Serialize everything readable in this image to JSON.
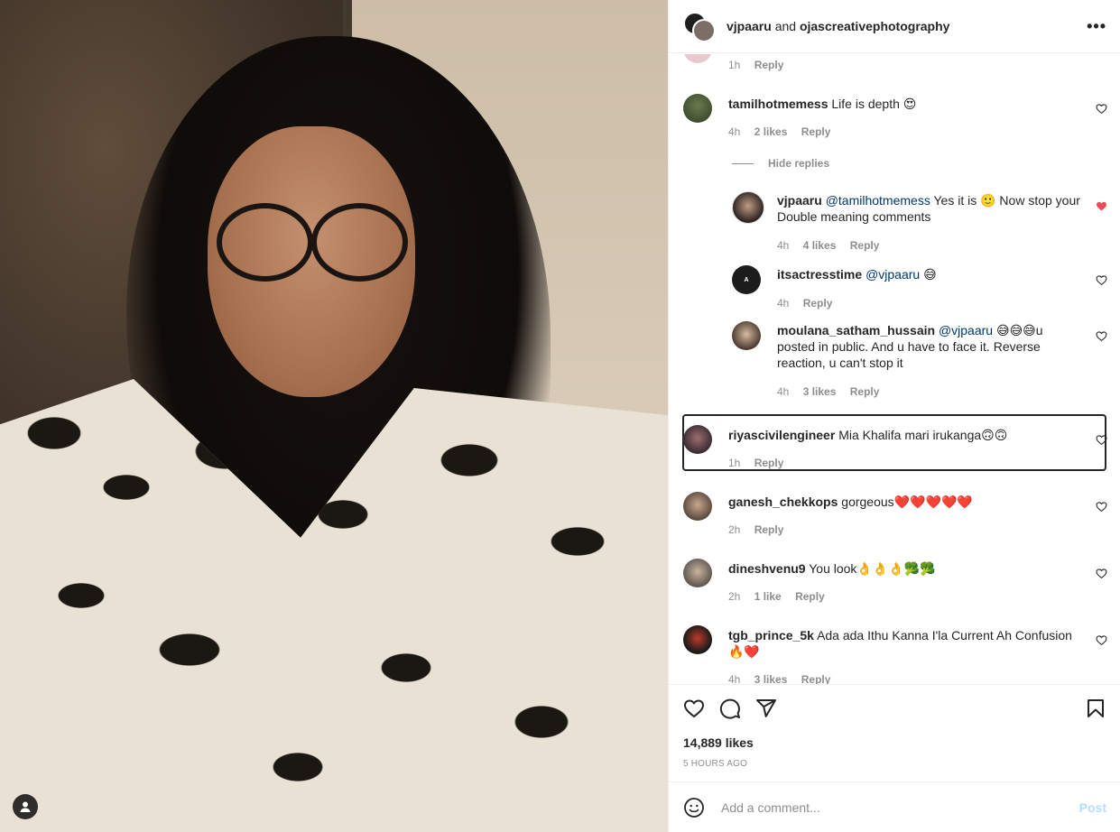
{
  "header": {
    "user1": "vjpaaru",
    "and": "and",
    "user2": "ojascreativephotography",
    "more_label": "•••"
  },
  "top_meta": {
    "time": "1h",
    "reply": "Reply"
  },
  "hide_replies": "Hide replies",
  "comments": [
    {
      "user": "tamilhotmemess",
      "text": "Life is depth 😍",
      "time": "4h",
      "likes": "2 likes",
      "reply": "Reply"
    },
    {
      "user": "vjpaaru",
      "mention": "@tamilhotmemess",
      "text": "Yes it is 🙂 Now stop your Double meaning comments",
      "time": "4h",
      "likes": "4 likes",
      "reply": "Reply",
      "liked": true
    },
    {
      "user": "itsactresstime",
      "mention": "@vjpaaru",
      "text": "😅",
      "time": "4h",
      "likes": "",
      "reply": "Reply"
    },
    {
      "user": "moulana_satham_hussain",
      "mention": "@vjpaaru",
      "text": "😅😅😅u posted in public. And u have to face it. Reverse reaction, u can't stop it",
      "time": "4h",
      "likes": "3 likes",
      "reply": "Reply"
    },
    {
      "user": "riyascivilengineer",
      "text": "Mia Khalifa mari irukanga🙃🙃",
      "time": "1h",
      "likes": "",
      "reply": "Reply"
    },
    {
      "user": "ganesh_chekkops",
      "text": "gorgeous❤️❤️❤️❤️❤️",
      "time": "2h",
      "likes": "",
      "reply": "Reply"
    },
    {
      "user": "dineshvenu9",
      "text": "You look👌👌👌🥦🥦",
      "time": "2h",
      "likes": "1 like",
      "reply": "Reply"
    },
    {
      "user": "tgb_prince_5k",
      "text": "Ada ada Ithu Kanna I'la Current Ah Confusion 🔥❤️",
      "time": "4h",
      "likes": "3 likes",
      "reply": "Reply"
    }
  ],
  "likes_count": "14,889 likes",
  "post_time": "5 HOURS AGO",
  "add_comment": {
    "placeholder": "Add a comment...",
    "post_label": "Post"
  },
  "colors": {
    "link": "#00376b",
    "muted": "#8e8e8e",
    "liked_heart": "#ed4956",
    "post_disabled": "#b2dffc"
  }
}
